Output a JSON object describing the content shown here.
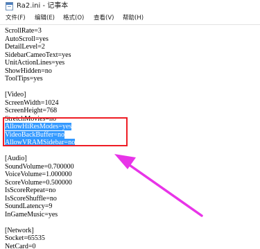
{
  "window": {
    "title": "Ra2.ini - 记事本",
    "icon": "notepad-icon"
  },
  "menubar": {
    "items": [
      {
        "label": "文件(F)"
      },
      {
        "label": "编辑(E)"
      },
      {
        "label": "格式(O)"
      },
      {
        "label": "查看(V)"
      },
      {
        "label": "帮助(H)"
      }
    ]
  },
  "editor": {
    "lines": [
      {
        "text": "ScrollRate=3",
        "selected": false
      },
      {
        "text": "AutoScroll=yes",
        "selected": false
      },
      {
        "text": "DetailLevel=2",
        "selected": false
      },
      {
        "text": "SidebarCameoText=yes",
        "selected": false
      },
      {
        "text": "UnitActionLines=yes",
        "selected": false
      },
      {
        "text": "ShowHidden=no",
        "selected": false
      },
      {
        "text": "ToolTips=yes",
        "selected": false
      },
      {
        "text": "",
        "selected": false
      },
      {
        "text": "[Video]",
        "selected": false
      },
      {
        "text": "ScreenWidth=1024",
        "selected": false
      },
      {
        "text": "ScreenHeight=768",
        "selected": false
      },
      {
        "text": "StretchMovies=no",
        "selected": false
      },
      {
        "text": "AllowHiResModes=yes",
        "selected": true
      },
      {
        "text": "VideoBackBuffer=no",
        "selected": true
      },
      {
        "text": "AllowVRAMSidebar=no",
        "selected": true
      },
      {
        "text": "",
        "selected": false
      },
      {
        "text": "[Audio]",
        "selected": false
      },
      {
        "text": "SoundVolume=0.700000",
        "selected": false
      },
      {
        "text": "VoiceVolume=1.000000",
        "selected": false
      },
      {
        "text": "ScoreVolume=0.500000",
        "selected": false
      },
      {
        "text": "IsScoreRepeat=no",
        "selected": false
      },
      {
        "text": "IsScoreShuffle=no",
        "selected": false
      },
      {
        "text": "SoundLatency=9",
        "selected": false
      },
      {
        "text": "InGameMusic=yes",
        "selected": false
      },
      {
        "text": "",
        "selected": false
      },
      {
        "text": "[Network]",
        "selected": false
      },
      {
        "text": "Socket=65535",
        "selected": false
      },
      {
        "text": "NetCard=0",
        "selected": false
      }
    ]
  },
  "annotation": {
    "box_color": "#ee1c24",
    "arrow_color": "#e834e8",
    "selection_color": "#3399ff"
  }
}
